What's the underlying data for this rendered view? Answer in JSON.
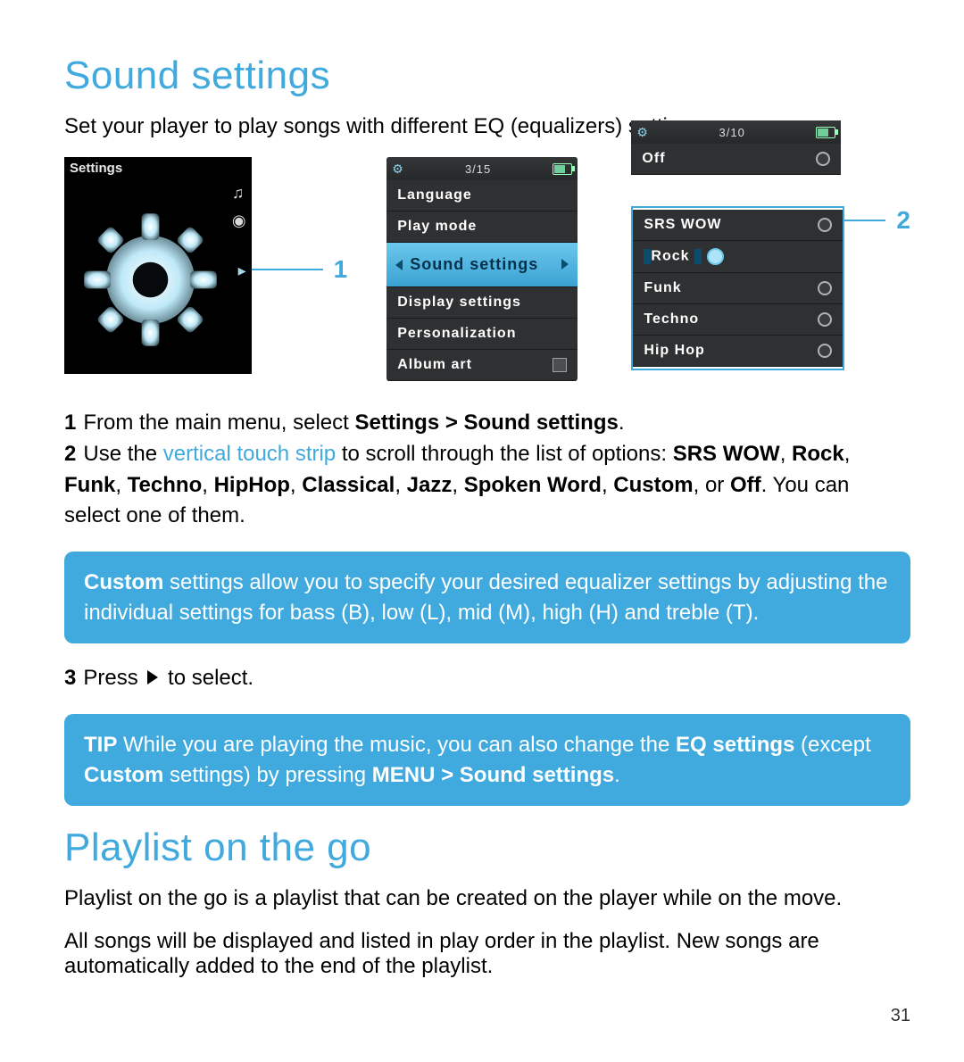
{
  "section1": {
    "title": "Sound settings",
    "lead": "Set your player to play songs with different EQ (equalizers) settings."
  },
  "screen1": {
    "header": "Settings",
    "callout": "1"
  },
  "screen2": {
    "counter": "3/15",
    "items": [
      "Language",
      "Play mode",
      "Sound settings",
      "Display settings",
      "Personalization",
      "Album art"
    ],
    "selected": "Sound settings"
  },
  "screen3": {
    "counter": "3/10",
    "items": [
      "Off",
      "SRS WOW",
      "Rock",
      "Funk",
      "Techno",
      "Hip Hop"
    ],
    "selected": "Rock",
    "callout": "2"
  },
  "steps": {
    "s1_num": "1",
    "s1_a": "From the main menu, select ",
    "s1_b": "Settings > Sound settings",
    "s1_c": ".",
    "s2_num": "2",
    "s2_a": "Use the ",
    "s2_link": "vertical touch strip",
    "s2_b": " to scroll through the list of options: ",
    "s2_bold1": "SRS WOW",
    "s2_comma1": ", ",
    "s2_bold2": "Rock",
    "s2_comma2": ", ",
    "s2_bold3": "Funk",
    "s2_comma3": ", ",
    "s2_bold4": "Techno",
    "s2_comma4": ", ",
    "s2_bold5": "HipHop",
    "s2_comma5": ", ",
    "s2_bold6": "Classical",
    "s2_comma6": ", ",
    "s2_bold7": "Jazz",
    "s2_comma7": ", ",
    "s2_bold8": "Spoken Word",
    "s2_comma8": ", ",
    "s2_bold9": "Custom",
    "s2_comma9": ", or ",
    "s2_bold10": "Off",
    "s2_tail": ". You can select one of them.",
    "s3_num": "3",
    "s3_a": "Press ",
    "s3_b": " to select."
  },
  "box1": {
    "b1": "Custom",
    "t1": " settings allow you to specify your desired equalizer settings by adjusting the individual settings for bass (B), low (L), mid (M), high (H) and treble (T)."
  },
  "box2": {
    "b1": "TIP",
    "t1": " While you are playing the music, you can also change the ",
    "b2": "EQ settings",
    "t2": " (except ",
    "b3": "Custom",
    "t3": " settings) by pressing ",
    "b4": "MENU > Sound settings",
    "t4": "."
  },
  "section2": {
    "title": "Playlist on the go",
    "p1_b": "Playlist on the go",
    "p1_t": " is a playlist that can be created on the player while on the move.",
    "p2": "All songs will be displayed and listed in play order in the playlist. New songs are automatically added to the end of the playlist."
  },
  "page_number": "31"
}
